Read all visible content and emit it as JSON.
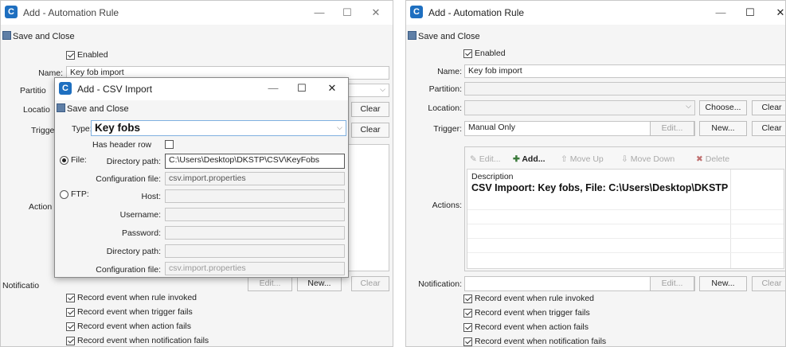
{
  "left": {
    "window_title": "Add - Automation Rule",
    "save_close": "Save and Close",
    "enabled_label": "Enabled",
    "name_label": "Name:",
    "name_value": "Key fob import",
    "partition_label": "Partitio",
    "location_label": "Locatio",
    "trigger_label": "Trigge",
    "actions_label": "Action",
    "notification_label": "Notificatio",
    "clear1": "Clear",
    "clear2": "Clear",
    "clear3": "Clear",
    "new_btn": "New...",
    "edit_btn": "Edit...",
    "events": [
      "Record event when rule invoked",
      "Record event when trigger fails",
      "Record event when action fails",
      "Record event when notification fails"
    ]
  },
  "csv": {
    "window_title": "Add - CSV Import",
    "save_close": "Save and Close",
    "type_label": "Type:",
    "type_value": "Key fobs",
    "header_row_label": "Has header row",
    "file_label": "File:",
    "dir_path_label": "Directory path:",
    "dir_path_value": "C:\\Users\\Desktop\\DKSTP\\CSV\\KeyFobs",
    "config_file_label": "Configuration file:",
    "config_file_value": "csv.import.properties",
    "ftp_label": "FTP:",
    "host_label": "Host:",
    "username_label": "Username:",
    "password_label": "Password:",
    "ftp_dir_label": "Directory path:",
    "ftp_config_label": "Configuration file:",
    "ftp_config_value": "csv.import.properties"
  },
  "right": {
    "window_title": "Add - Automation Rule",
    "save_close": "Save and Close",
    "enabled_label": "Enabled",
    "name_label": "Name:",
    "name_value": "Key fob import",
    "partition_label": "Partition:",
    "location_label": "Location:",
    "choose_btn": "Choose...",
    "clear_loc": "Clear",
    "trigger_label": "Trigger:",
    "trigger_value": "Manual Only",
    "edit_trigger": "Edit...",
    "new_trigger": "New...",
    "clear_trigger": "Clear",
    "toolbar": {
      "edit": "Edit...",
      "add": "Add...",
      "move_up": "Move Up",
      "move_down": "Move Down",
      "delete": "Delete"
    },
    "actions_label": "Actions:",
    "table_header": "Description",
    "table_row": "CSV Impoort: Key fobs, File: C:\\Users\\Desktop\\DKSTP",
    "notification_label": "Notification:",
    "edit_notif": "Edit...",
    "new_notif": "New...",
    "clear_notif": "Clear",
    "events": [
      "Record event when rule invoked",
      "Record event when trigger fails",
      "Record event when action fails",
      "Record event when notification fails"
    ]
  }
}
